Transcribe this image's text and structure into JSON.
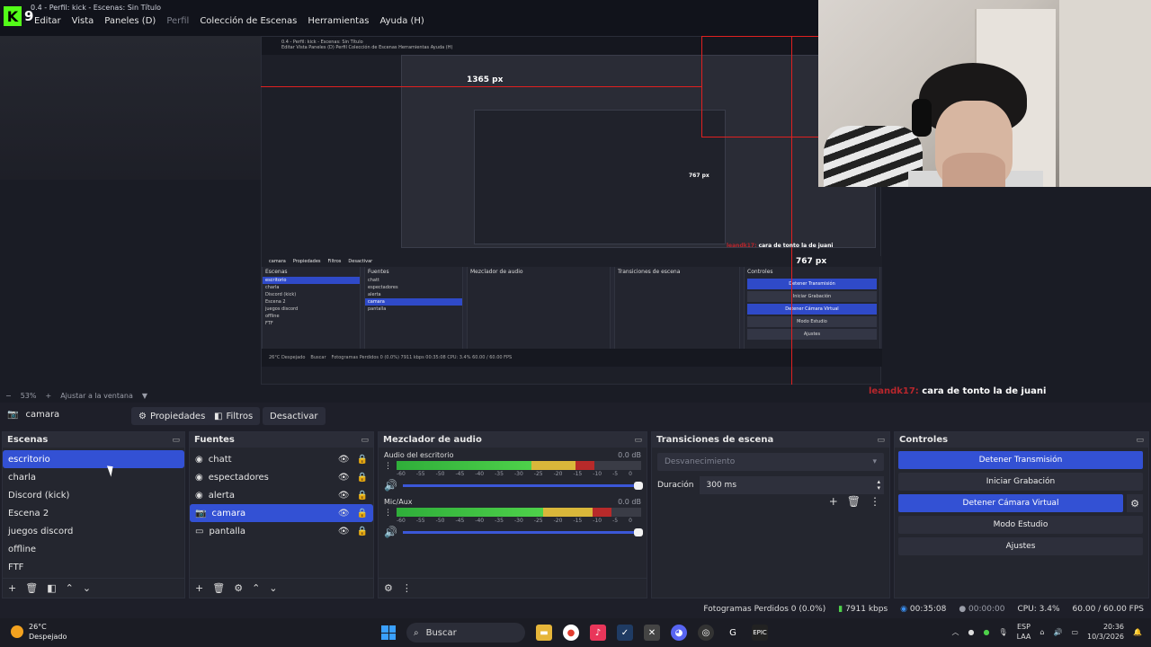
{
  "window": {
    "title": "0.4 - Perfil: kick - Escenas: Sin Título",
    "logo_letter": "K",
    "logo_number": "9"
  },
  "menu": [
    {
      "label": "Editar",
      "dim": false
    },
    {
      "label": "Vista",
      "dim": false
    },
    {
      "label": "Paneles (D)",
      "dim": false
    },
    {
      "label": "Perfil",
      "dim": true
    },
    {
      "label": "Colección de Escenas",
      "dim": false
    },
    {
      "label": "Herramientas",
      "dim": false
    },
    {
      "label": "Ayuda (H)",
      "dim": false
    }
  ],
  "preview": {
    "nested_title": "0.4 - Perfil: kick - Escenas: Sin Título",
    "nested_menu": "Editar  Vista  Paneles (D)  Perfil  Colección de Escenas  Herramientas  Ayuda (H)",
    "width_label": "1365 px",
    "height_label": "767 px",
    "inner_height_label": "767 px",
    "chat_user": "leandk17:",
    "chat_msg": "cara de tonto la de juani",
    "nested_panels": {
      "escenas_title": "Escenas",
      "escenas": [
        "escritorio",
        "charla",
        "Discord (kick)",
        "Escena 2",
        "juegos discord",
        "offline",
        "FTF"
      ],
      "fuentes_title": "Fuentes",
      "fuentes": [
        "chatt",
        "espectadores",
        "alerta",
        "camara",
        "pantalla"
      ],
      "mezclador_title": "Mezclador de audio",
      "transiciones_title": "Transiciones de escena",
      "controles_title": "Controles",
      "controles": [
        "Detener Transmisión",
        "Iniciar Grabación",
        "Detener Cámara Virtual",
        "Modo Estudio",
        "Ajustes"
      ],
      "source_name": "camara",
      "btn_props": "Propiedades",
      "btn_filters": "Filtros",
      "btn_deactivate": "Desactivar",
      "status": "Fotogramas Perdidos 0 (0.0%)  7911 kbps  00:35:08  CPU: 3.4%  60.00 / 60.00 FPS",
      "weather": "26°C Despejado",
      "search": "Buscar"
    }
  },
  "zoom": {
    "value": "53%",
    "fit_label": "Ajustar a la ventana"
  },
  "chat": {
    "user": "leandk17:",
    "message": "cara de tonto la de juani"
  },
  "source_toolbar": {
    "source_name": "camara",
    "properties": "Propiedades",
    "filters": "Filtros",
    "deactivate": "Desactivar"
  },
  "scenes": {
    "title": "Escenas",
    "items": [
      "escritorio",
      "charla",
      "Discord (kick)",
      "Escena 2",
      "juegos discord",
      "offline",
      "FTF"
    ],
    "selected": "escritorio"
  },
  "sources": {
    "title": "Fuentes",
    "items": [
      {
        "name": "chatt",
        "icon": "browser-icon"
      },
      {
        "name": "espectadores",
        "icon": "browser-icon"
      },
      {
        "name": "alerta",
        "icon": "browser-icon"
      },
      {
        "name": "camara",
        "icon": "camera-icon"
      },
      {
        "name": "pantalla",
        "icon": "monitor-icon"
      }
    ],
    "selected": "camara"
  },
  "mixer": {
    "title": "Mezclador de audio",
    "channels": [
      {
        "name": "Audio del escritorio",
        "db": "0.0 dB",
        "green": 0.55,
        "yellow": 0.18,
        "red": 0.08
      },
      {
        "name": "Mic/Aux",
        "db": "0.0 dB",
        "green": 0.6,
        "yellow": 0.2,
        "red": 0.08
      }
    ],
    "scale": [
      "-60",
      "-55",
      "-50",
      "-45",
      "-40",
      "-35",
      "-30",
      "-25",
      "-20",
      "-15",
      "-10",
      "-5",
      "0"
    ]
  },
  "transitions": {
    "title": "Transiciones de escena",
    "selected": "Desvanecimiento",
    "duration_label": "Duración",
    "duration_value": "300 ms"
  },
  "controls": {
    "title": "Controles",
    "stop_stream": "Detener Transmisión",
    "start_record": "Iniciar Grabación",
    "stop_vcam": "Detener Cámara Virtual",
    "studio_mode": "Modo Estudio",
    "settings": "Ajustes"
  },
  "status": {
    "dropped_frames": "Fotogramas Perdidos 0 (0.0%)",
    "bitrate": "7911 kbps",
    "stream_time": "00:35:08",
    "record_time": "00:00:00",
    "cpu": "CPU: 3.4%",
    "fps": "60.00 / 60.00 FPS"
  },
  "taskbar": {
    "temperature": "26°C",
    "weather": "Despejado",
    "search": "Buscar",
    "lang1": "ESP",
    "lang2": "LAA",
    "time": "20:36",
    "date": "10/3/2026"
  },
  "colors": {
    "accent": "#3351d4",
    "kick_green": "#53fc18",
    "chat_user": "#b8262c"
  }
}
